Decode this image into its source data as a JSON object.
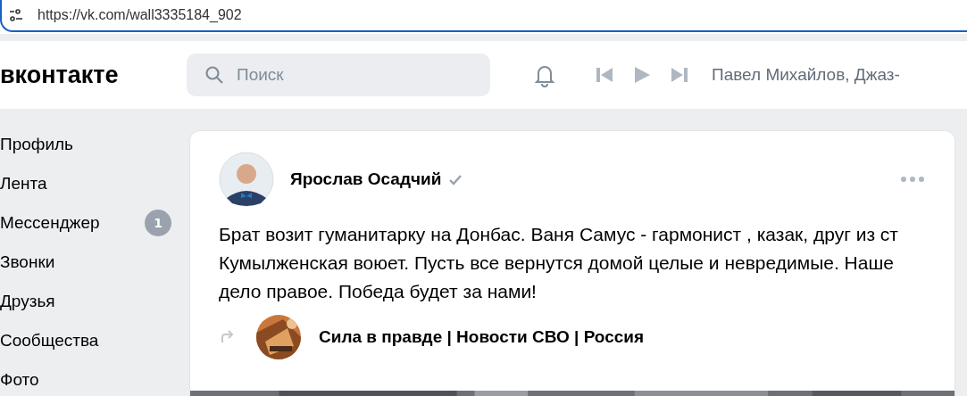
{
  "address_bar": {
    "url": "https://vk.com/wall3335184_902"
  },
  "header": {
    "logo": "вконтакте",
    "search": {
      "placeholder": "Поиск"
    },
    "player": {
      "track": "Павел Михайлов, Джаз-"
    }
  },
  "sidebar": {
    "items": [
      {
        "label": "Профиль"
      },
      {
        "label": "Лента"
      },
      {
        "label": "Мессенджер",
        "badge": "1"
      },
      {
        "label": "Звонки"
      },
      {
        "label": "Друзья"
      },
      {
        "label": "Сообщества"
      },
      {
        "label": "Фото"
      }
    ]
  },
  "post": {
    "author": "Ярослав Осадчий",
    "verified": true,
    "text": "Брат возит гуманитарку на Донбас. Ваня Самус - гармонист , казак, друг из ст Кумылженская воюет. Пусть все вернутся домой целые и невредимые. Наше дело правое. Победа будет за нами!",
    "repost": {
      "source": "Сила в правде | Новости СВО | Россия"
    }
  }
}
